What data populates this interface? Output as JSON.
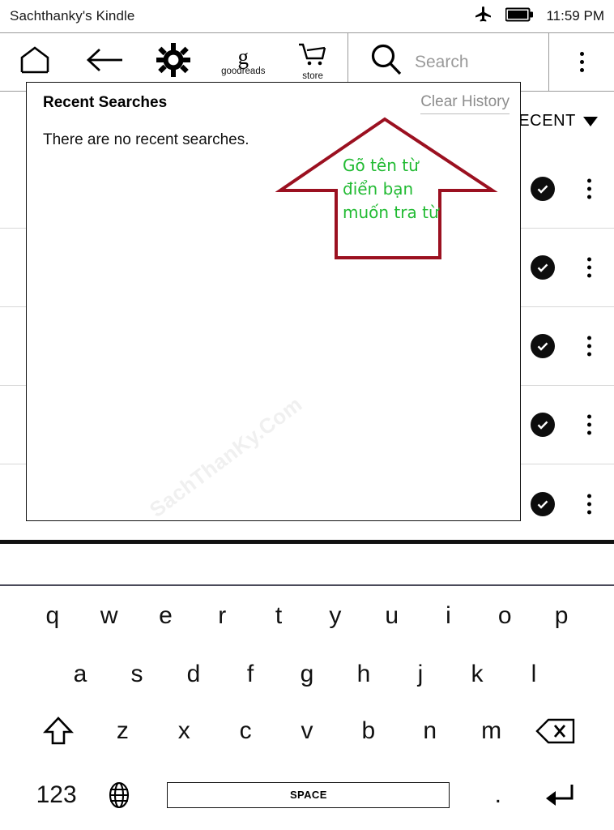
{
  "status_bar": {
    "device_name": "Sachthanky's Kindle",
    "clock": "11:59 PM",
    "airplane_icon": "airplane-icon",
    "battery_icon": "battery-full-icon"
  },
  "toolbar": {
    "home_icon": "home-icon",
    "back_icon": "back-arrow-icon",
    "settings_icon": "gear-icon",
    "goodreads": {
      "glyph": "g",
      "label": "goodreads"
    },
    "store": {
      "icon": "shopping-cart-icon",
      "label": "store"
    },
    "search": {
      "icon": "search-icon",
      "placeholder": "Search",
      "value": ""
    },
    "overflow_icon": "three-dots-vertical-icon"
  },
  "library": {
    "sort_label": "RECENT",
    "sort_caret_icon": "chevron-down-icon",
    "rows": [
      {
        "downloaded_icon": "check-circle-icon",
        "menu_icon": "three-dots-vertical-icon"
      },
      {
        "downloaded_icon": "check-circle-icon",
        "menu_icon": "three-dots-vertical-icon"
      },
      {
        "downloaded_icon": "check-circle-icon",
        "menu_icon": "three-dots-vertical-icon"
      },
      {
        "downloaded_icon": "check-circle-icon",
        "menu_icon": "three-dots-vertical-icon"
      },
      {
        "downloaded_icon": "check-circle-icon",
        "menu_icon": "three-dots-vertical-icon"
      }
    ]
  },
  "recent_searches_panel": {
    "title": "Recent Searches",
    "clear_history_label": "Clear History",
    "empty_message": "There are no recent searches.",
    "watermark": "SachThanKy.Com"
  },
  "annotation": {
    "text": "Gõ tên từ điển bạn muốn tra từ",
    "arrow_color": "#9b1020",
    "text_color": "#22bb33",
    "shape": "up-arrow"
  },
  "keyboard": {
    "row1": [
      "q",
      "w",
      "e",
      "r",
      "t",
      "y",
      "u",
      "i",
      "o",
      "p"
    ],
    "row2": [
      "a",
      "s",
      "d",
      "f",
      "g",
      "h",
      "j",
      "k",
      "l"
    ],
    "row3_shift_icon": "shift-up-arrow-icon",
    "row3": [
      "z",
      "x",
      "c",
      "v",
      "b",
      "n",
      "m"
    ],
    "row3_backspace_icon": "backspace-icon",
    "numbers_key": "123",
    "globe_icon": "globe-language-icon",
    "space_key": "SPACE",
    "period_key": ".",
    "enter_icon": "enter-return-icon"
  },
  "colors": {
    "accent_red": "#9b1020",
    "accent_green": "#22bb33",
    "placeholder_gray": "#9a9a9a",
    "badge_black": "#0d0d0d"
  }
}
